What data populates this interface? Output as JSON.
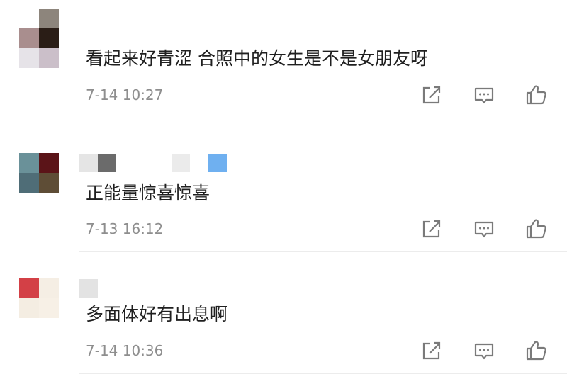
{
  "comments": [
    {
      "text": "看起来好青涩 合照中的女生是不是女朋友呀",
      "time": "7-14 10:27",
      "avatar_colors": [
        "#ffffff",
        "#8d857c",
        "#a98e8e",
        "#2a1d16",
        "#e6e3e8",
        "#cbbfc9"
      ],
      "username_colors": []
    },
    {
      "text": "正能量惊喜惊喜",
      "time": "7-13 16:12",
      "avatar_colors": [
        "#6a9199",
        "#5b1418",
        "#4f6d77",
        "#5e4d36"
      ],
      "username_colors": [
        "#e5e5e5",
        "#6b6b6b",
        "#ffffff",
        "#ffffff",
        "#ffffff",
        "#ebebeb",
        "#ffffff",
        "#6fb0f0"
      ]
    },
    {
      "text": "多面体好有出息啊",
      "time": "7-14 10:36",
      "avatar_colors": [
        "#d34046",
        "#f5eee4",
        "#f4ede2",
        "#f7f0e6"
      ],
      "username_colors": [
        "#e3e3e3"
      ]
    }
  ],
  "actions": {
    "share_icon": "share-icon",
    "reply_icon": "comment-icon",
    "like_icon": "thumbs-up-icon",
    "icon_color": "#7a7a7a"
  }
}
